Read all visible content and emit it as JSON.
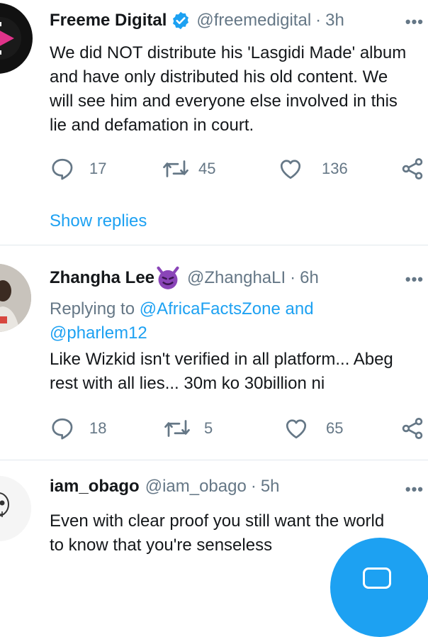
{
  "tweets": [
    {
      "name": "Freeme Digital",
      "verified": true,
      "handle": "@freemedigital",
      "time": "3h",
      "more": "•••",
      "lines": [
        "We did NOT distribute his 'Lasgidi Made' album",
        "and have only distributed his old content. We",
        "will see him and everyone else involved in this",
        "lie and defamation in court."
      ],
      "replies": "17",
      "retweets": "45",
      "likes": "136",
      "show_replies": "Show replies"
    },
    {
      "name": "Zhangha Lee",
      "emoji": "😈",
      "handle": "@ZhanghaLI",
      "time": "6h",
      "more": "•••",
      "replying_prefix": "Replying to",
      "replying_user1": "@AfricaFactsZone",
      "replying_and": "and",
      "replying_user2": "@pharlem12",
      "lines": [
        "Like Wizkid isn't verified in all platform... Abeg",
        "rest with all lies... 30m ko 30billion ni"
      ],
      "replies": "18",
      "retweets": "5",
      "likes": "65"
    },
    {
      "name": "iam_obago",
      "handle": "@iam_obago",
      "time": "5h",
      "more": "•••",
      "lines": [
        "Even with clear proof you still want the world",
        "to know that you're senseless"
      ]
    }
  ],
  "colors": {
    "accent": "#1da1f2",
    "secondary_text": "#657786",
    "divider": "#e1e8ed"
  },
  "icons": [
    "reply-icon",
    "retweet-icon",
    "like-icon",
    "share-icon",
    "more-icon",
    "verified-badge-icon",
    "compose-icon"
  ]
}
